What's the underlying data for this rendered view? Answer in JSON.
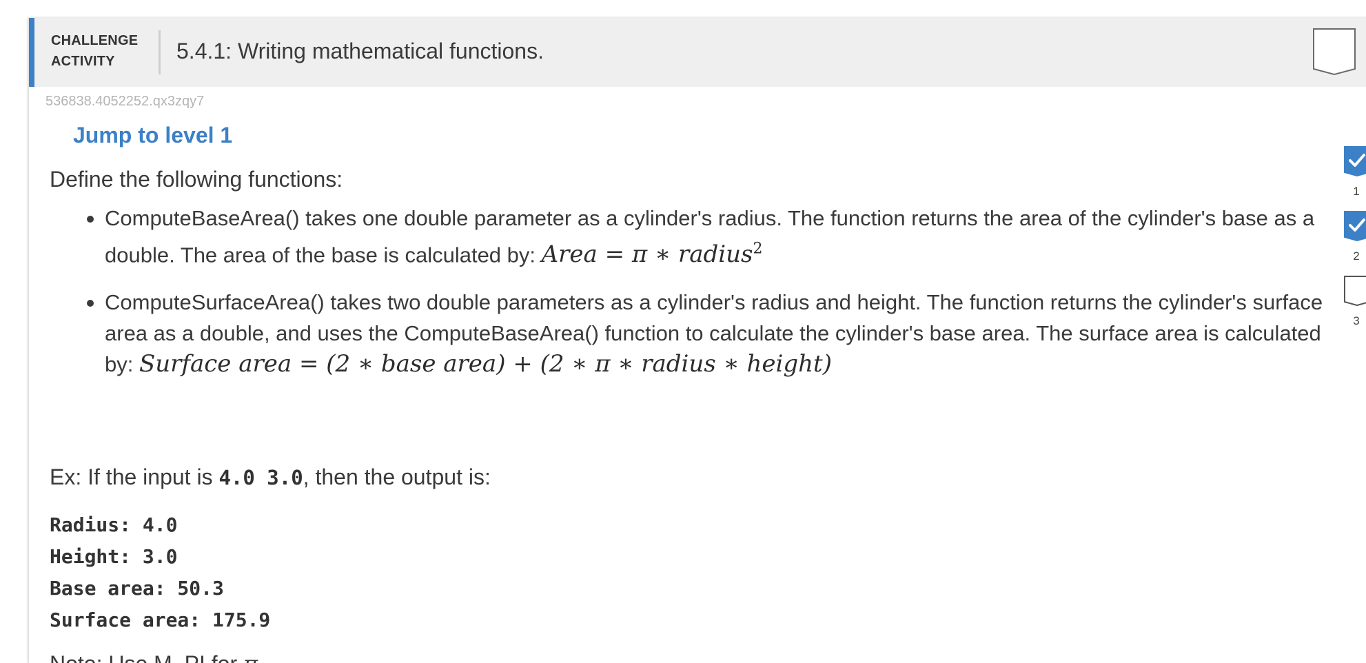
{
  "header": {
    "caption_line1": "CHALLENGE",
    "caption_line2": "ACTIVITY",
    "title": "5.4.1: Writing mathematical functions."
  },
  "activity_id": "536838.4052252.qx3zqy7",
  "jump_link": "Jump to level 1",
  "intro": "Define the following functions:",
  "bullets": [
    {
      "text": "ComputeBaseArea() takes one double parameter as a cylinder's radius. The function returns the area of the cylinder's base as a double. The area of the base is calculated by: ",
      "formula": "Area  =  π ∗ radius",
      "formula_sup": "2"
    },
    {
      "text": "ComputeSurfaceArea() takes two double parameters as a cylinder's radius and height. The function returns the cylinder's surface area as a double, and uses the ComputeBaseArea() function to calculate the cylinder's base area. The surface area is calculated by: ",
      "formula": "Surface area  =  (2 ∗ base area)  +  (2 ∗ π ∗ radius ∗ height)"
    }
  ],
  "example": {
    "prefix": "Ex: If the input is ",
    "input": "4.0 3.0",
    "suffix": ", then the output is:"
  },
  "output": "Radius: 4.0\nHeight: 3.0\nBase area: 50.3\nSurface area: 175.9",
  "note": {
    "prefix": "Note: Use M_PI for ",
    "pi": "π",
    "suffix": "."
  },
  "levels": [
    {
      "number": "1",
      "completed": true
    },
    {
      "number": "2",
      "completed": true
    },
    {
      "number": "3",
      "completed": false
    }
  ],
  "colors": {
    "accent": "#3c80c7",
    "header_bg": "#efefef",
    "text": "#3a3a3a"
  }
}
